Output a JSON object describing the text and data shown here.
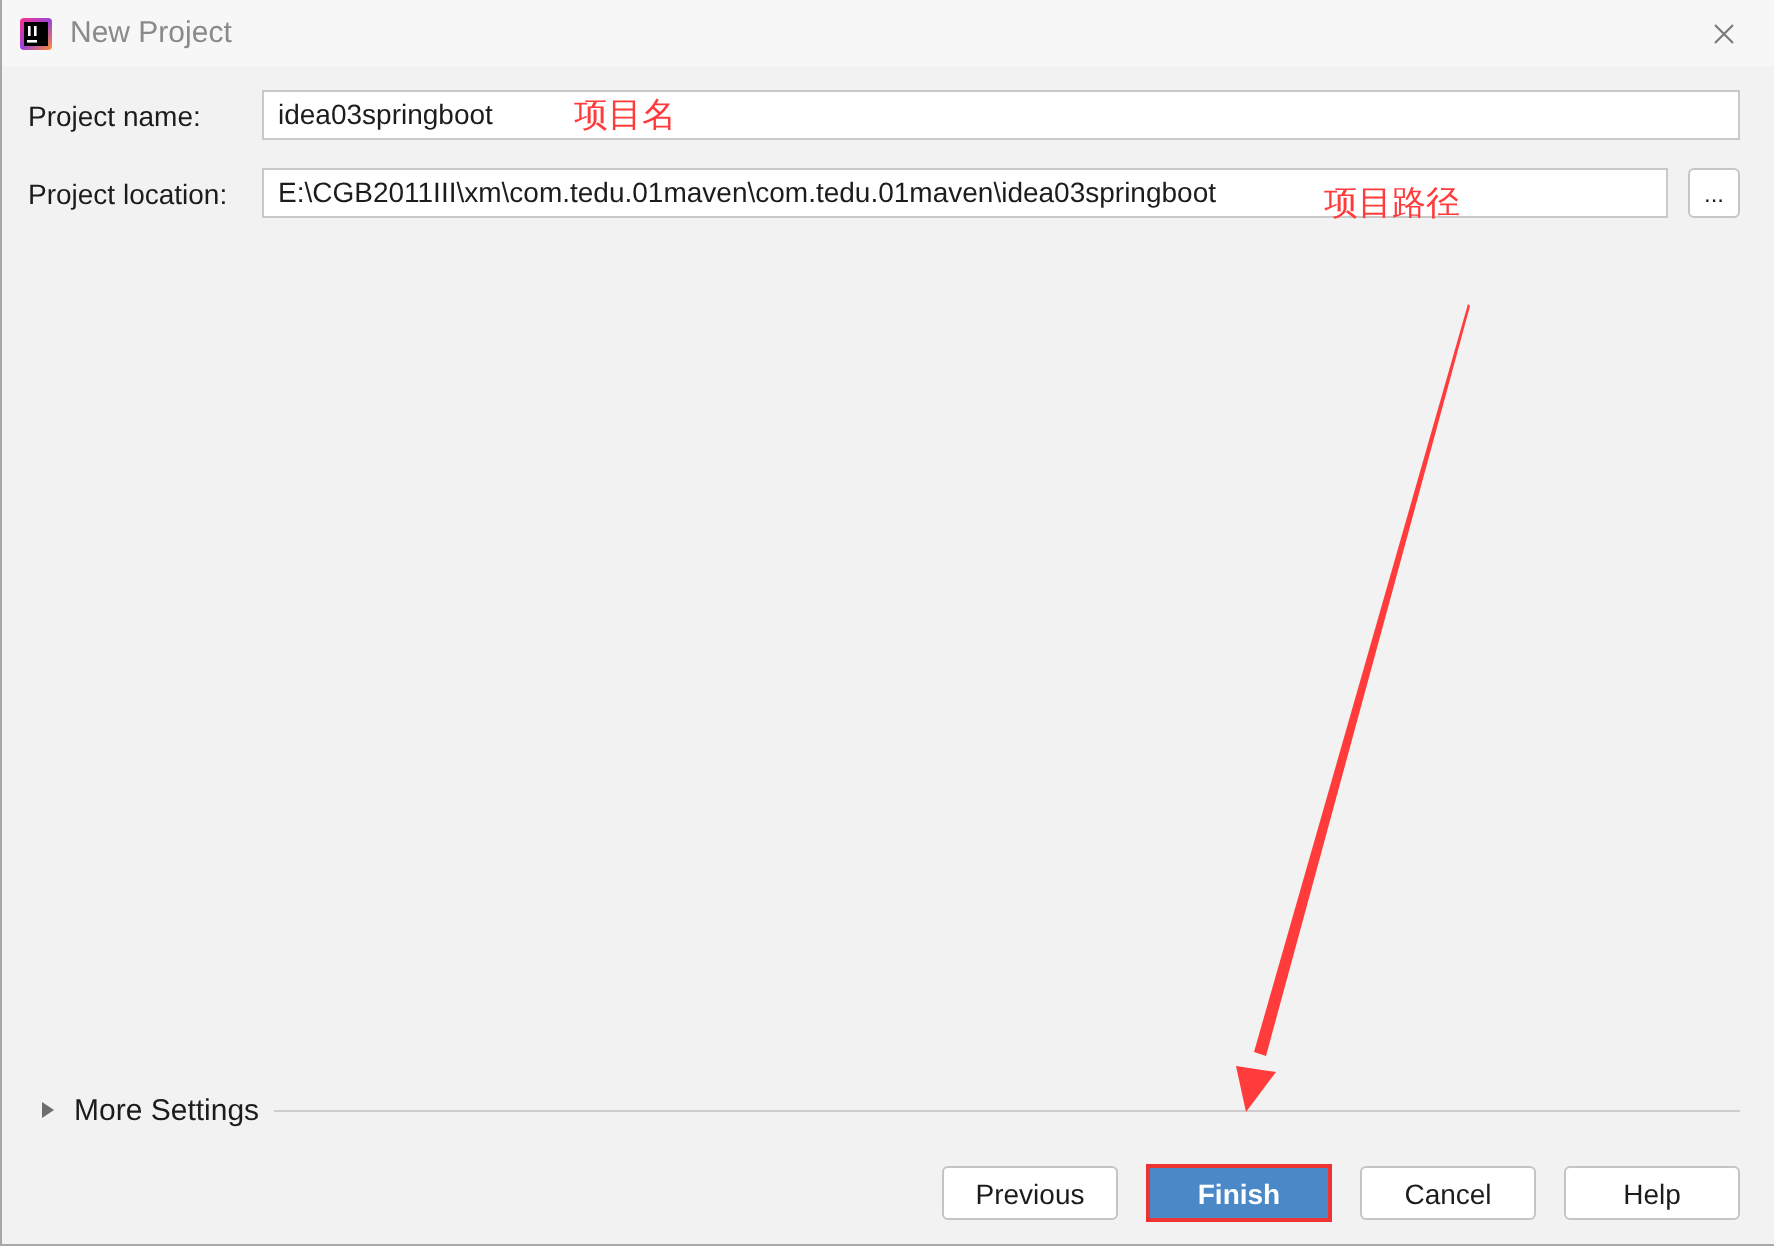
{
  "window": {
    "title": "New Project"
  },
  "fields": [
    {
      "label": "Project name:",
      "value": "idea03springboot",
      "annotation": "项目名"
    },
    {
      "label": "Project location:",
      "value": "E:\\CGB2011III\\xm\\com.tedu.01maven\\com.tedu.01maven\\idea03springboot",
      "browse_button": "...",
      "annotation": "项目路径"
    }
  ],
  "more_settings": {
    "label": "More Settings",
    "expanded": false
  },
  "buttons": [
    {
      "label": "Previous",
      "default": false,
      "highlighted": false
    },
    {
      "label": "Finish",
      "default": true,
      "highlighted": true
    },
    {
      "label": "Cancel",
      "default": false,
      "highlighted": false
    },
    {
      "label": "Help",
      "default": false,
      "highlighted": false
    }
  ]
}
